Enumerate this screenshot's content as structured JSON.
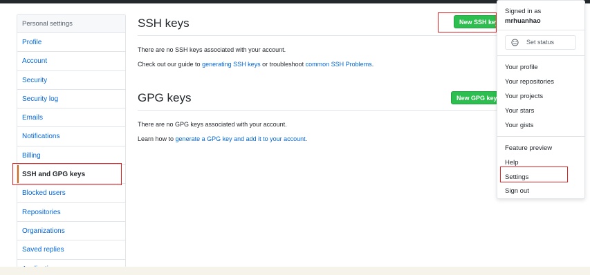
{
  "sidebar": {
    "header": "Personal settings",
    "items": [
      {
        "label": "Profile"
      },
      {
        "label": "Account"
      },
      {
        "label": "Security"
      },
      {
        "label": "Security log"
      },
      {
        "label": "Emails"
      },
      {
        "label": "Notifications"
      },
      {
        "label": "Billing"
      },
      {
        "label": "SSH and GPG keys"
      },
      {
        "label": "Blocked users"
      },
      {
        "label": "Repositories"
      },
      {
        "label": "Organizations"
      },
      {
        "label": "Saved replies"
      },
      {
        "label": "Applications"
      }
    ],
    "selected": "SSH and GPG keys"
  },
  "ssh": {
    "title": "SSH keys",
    "new_button": "New SSH key",
    "empty_text": "There are no SSH keys associated with your account.",
    "guide_prefix": "Check out our guide to ",
    "guide_link": "generating SSH keys",
    "guide_middle": " or troubleshoot ",
    "problems_link": "common SSH Problems",
    "guide_suffix": "."
  },
  "gpg": {
    "title": "GPG keys",
    "new_button": "New GPG key",
    "empty_text": "There are no GPG keys associated with your account.",
    "learn_prefix": "Learn how to ",
    "learn_link": "generate a GPG key and add it to your account",
    "learn_suffix": "."
  },
  "dropdown": {
    "signed_in_as": "Signed in as",
    "username": "mrhuanhao",
    "set_status": "Set status",
    "items_group1": [
      "Your profile",
      "Your repositories",
      "Your projects",
      "Your stars",
      "Your gists"
    ],
    "items_group2": [
      "Feature preview",
      "Help",
      "Settings",
      "Sign out"
    ]
  },
  "colors": {
    "link": "#0366d6",
    "button_green": "#2cbe4e",
    "highlight_red": "#e02020"
  }
}
